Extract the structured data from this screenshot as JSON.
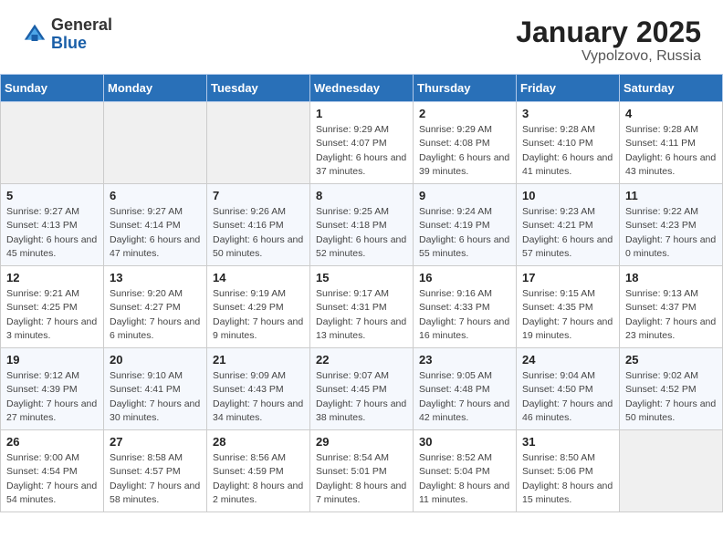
{
  "header": {
    "logo_general": "General",
    "logo_blue": "Blue",
    "month_title": "January 2025",
    "location": "Vypolzovo, Russia"
  },
  "days_of_week": [
    "Sunday",
    "Monday",
    "Tuesday",
    "Wednesday",
    "Thursday",
    "Friday",
    "Saturday"
  ],
  "weeks": [
    [
      {
        "day": "",
        "info": ""
      },
      {
        "day": "",
        "info": ""
      },
      {
        "day": "",
        "info": ""
      },
      {
        "day": "1",
        "info": "Sunrise: 9:29 AM\nSunset: 4:07 PM\nDaylight: 6 hours and 37 minutes."
      },
      {
        "day": "2",
        "info": "Sunrise: 9:29 AM\nSunset: 4:08 PM\nDaylight: 6 hours and 39 minutes."
      },
      {
        "day": "3",
        "info": "Sunrise: 9:28 AM\nSunset: 4:10 PM\nDaylight: 6 hours and 41 minutes."
      },
      {
        "day": "4",
        "info": "Sunrise: 9:28 AM\nSunset: 4:11 PM\nDaylight: 6 hours and 43 minutes."
      }
    ],
    [
      {
        "day": "5",
        "info": "Sunrise: 9:27 AM\nSunset: 4:13 PM\nDaylight: 6 hours and 45 minutes."
      },
      {
        "day": "6",
        "info": "Sunrise: 9:27 AM\nSunset: 4:14 PM\nDaylight: 6 hours and 47 minutes."
      },
      {
        "day": "7",
        "info": "Sunrise: 9:26 AM\nSunset: 4:16 PM\nDaylight: 6 hours and 50 minutes."
      },
      {
        "day": "8",
        "info": "Sunrise: 9:25 AM\nSunset: 4:18 PM\nDaylight: 6 hours and 52 minutes."
      },
      {
        "day": "9",
        "info": "Sunrise: 9:24 AM\nSunset: 4:19 PM\nDaylight: 6 hours and 55 minutes."
      },
      {
        "day": "10",
        "info": "Sunrise: 9:23 AM\nSunset: 4:21 PM\nDaylight: 6 hours and 57 minutes."
      },
      {
        "day": "11",
        "info": "Sunrise: 9:22 AM\nSunset: 4:23 PM\nDaylight: 7 hours and 0 minutes."
      }
    ],
    [
      {
        "day": "12",
        "info": "Sunrise: 9:21 AM\nSunset: 4:25 PM\nDaylight: 7 hours and 3 minutes."
      },
      {
        "day": "13",
        "info": "Sunrise: 9:20 AM\nSunset: 4:27 PM\nDaylight: 7 hours and 6 minutes."
      },
      {
        "day": "14",
        "info": "Sunrise: 9:19 AM\nSunset: 4:29 PM\nDaylight: 7 hours and 9 minutes."
      },
      {
        "day": "15",
        "info": "Sunrise: 9:17 AM\nSunset: 4:31 PM\nDaylight: 7 hours and 13 minutes."
      },
      {
        "day": "16",
        "info": "Sunrise: 9:16 AM\nSunset: 4:33 PM\nDaylight: 7 hours and 16 minutes."
      },
      {
        "day": "17",
        "info": "Sunrise: 9:15 AM\nSunset: 4:35 PM\nDaylight: 7 hours and 19 minutes."
      },
      {
        "day": "18",
        "info": "Sunrise: 9:13 AM\nSunset: 4:37 PM\nDaylight: 7 hours and 23 minutes."
      }
    ],
    [
      {
        "day": "19",
        "info": "Sunrise: 9:12 AM\nSunset: 4:39 PM\nDaylight: 7 hours and 27 minutes."
      },
      {
        "day": "20",
        "info": "Sunrise: 9:10 AM\nSunset: 4:41 PM\nDaylight: 7 hours and 30 minutes."
      },
      {
        "day": "21",
        "info": "Sunrise: 9:09 AM\nSunset: 4:43 PM\nDaylight: 7 hours and 34 minutes."
      },
      {
        "day": "22",
        "info": "Sunrise: 9:07 AM\nSunset: 4:45 PM\nDaylight: 7 hours and 38 minutes."
      },
      {
        "day": "23",
        "info": "Sunrise: 9:05 AM\nSunset: 4:48 PM\nDaylight: 7 hours and 42 minutes."
      },
      {
        "day": "24",
        "info": "Sunrise: 9:04 AM\nSunset: 4:50 PM\nDaylight: 7 hours and 46 minutes."
      },
      {
        "day": "25",
        "info": "Sunrise: 9:02 AM\nSunset: 4:52 PM\nDaylight: 7 hours and 50 minutes."
      }
    ],
    [
      {
        "day": "26",
        "info": "Sunrise: 9:00 AM\nSunset: 4:54 PM\nDaylight: 7 hours and 54 minutes."
      },
      {
        "day": "27",
        "info": "Sunrise: 8:58 AM\nSunset: 4:57 PM\nDaylight: 7 hours and 58 minutes."
      },
      {
        "day": "28",
        "info": "Sunrise: 8:56 AM\nSunset: 4:59 PM\nDaylight: 8 hours and 2 minutes."
      },
      {
        "day": "29",
        "info": "Sunrise: 8:54 AM\nSunset: 5:01 PM\nDaylight: 8 hours and 7 minutes."
      },
      {
        "day": "30",
        "info": "Sunrise: 8:52 AM\nSunset: 5:04 PM\nDaylight: 8 hours and 11 minutes."
      },
      {
        "day": "31",
        "info": "Sunrise: 8:50 AM\nSunset: 5:06 PM\nDaylight: 8 hours and 15 minutes."
      },
      {
        "day": "",
        "info": ""
      }
    ]
  ]
}
